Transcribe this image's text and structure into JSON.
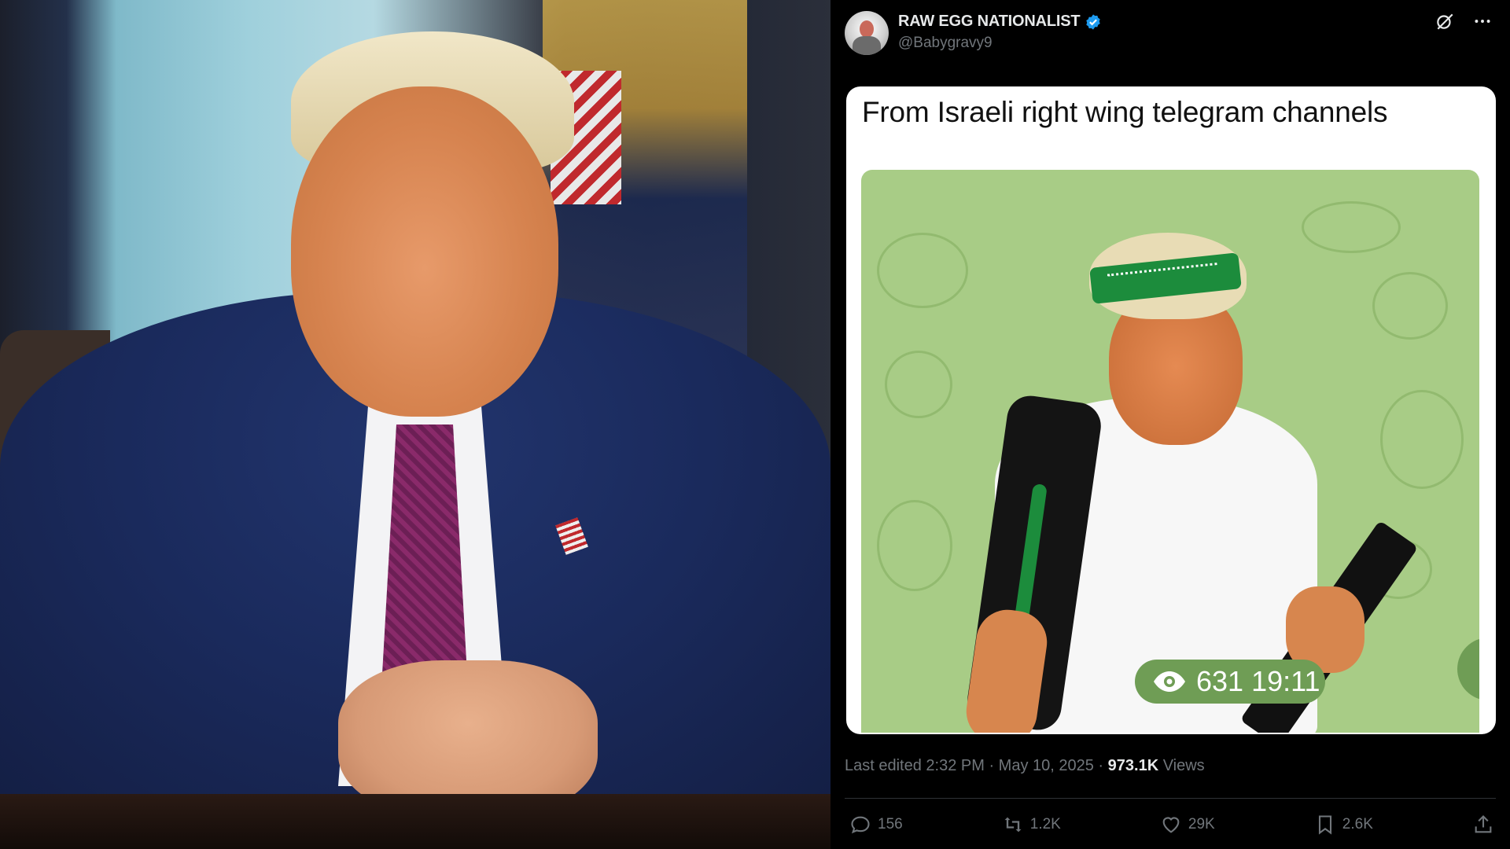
{
  "tweet": {
    "author": {
      "display_name": "RAW EGG NATIONALIST",
      "handle": "@Babygravy9",
      "verified": true
    },
    "text": "From Israeli right wing telegram channels",
    "embedded_image": {
      "views_overlay": "631 19:11"
    },
    "meta": {
      "edited": "Last edited 2:32 PM · May 10, 2025 · ",
      "views_count": "973.1K",
      "views_label": " Views"
    },
    "actions": {
      "replies": "156",
      "reposts": "1.2K",
      "likes": "29K",
      "bookmarks": "2.6K"
    }
  },
  "colors": {
    "background": "#000000",
    "text_primary": "#e7e9ea",
    "text_secondary": "#71767b",
    "verified_badge": "#1d9bf0",
    "meme_background": "#a8cc86"
  },
  "icons": [
    "verified-badge-icon",
    "grok-icon",
    "more-icon",
    "eye-icon",
    "reply-icon",
    "repost-icon",
    "like-icon",
    "bookmark-icon",
    "share-icon"
  ]
}
